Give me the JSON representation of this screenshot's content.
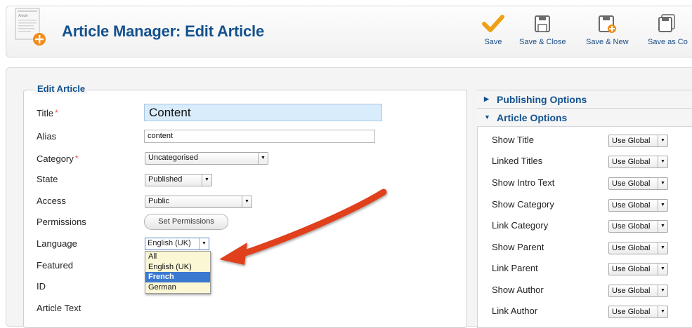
{
  "header": {
    "title": "Article Manager: Edit Article",
    "icon_text": "Article"
  },
  "toolbar": {
    "save": "Save",
    "save_close": "Save & Close",
    "save_new": "Save & New",
    "save_copy": "Save as Co"
  },
  "form": {
    "legend": "Edit Article",
    "labels": {
      "title": "Title",
      "alias": "Alias",
      "category": "Category",
      "state": "State",
      "access": "Access",
      "permissions": "Permissions",
      "language": "Language",
      "featured": "Featured",
      "id": "ID",
      "article_text": "Article Text"
    },
    "required_marker": "*",
    "values": {
      "title": "Content",
      "alias": "content",
      "category": "Uncategorised",
      "state": "Published",
      "access": "Public",
      "language": "English (UK)"
    },
    "set_permissions": "Set Permissions",
    "language_options": [
      "All",
      "English (UK)",
      "French",
      "German"
    ],
    "language_highlighted": "French"
  },
  "sidebar": {
    "publishing_options": "Publishing Options",
    "article_options": "Article Options",
    "options": [
      {
        "label": "Show Title",
        "value": "Use Global"
      },
      {
        "label": "Linked Titles",
        "value": "Use Global"
      },
      {
        "label": "Show Intro Text",
        "value": "Use Global"
      },
      {
        "label": "Show Category",
        "value": "Use Global"
      },
      {
        "label": "Link Category",
        "value": "Use Global"
      },
      {
        "label": "Show Parent",
        "value": "Use Global"
      },
      {
        "label": "Link Parent",
        "value": "Use Global"
      },
      {
        "label": "Show Author",
        "value": "Use Global"
      },
      {
        "label": "Link Author",
        "value": "Use Global"
      }
    ]
  },
  "colors": {
    "accent": "#14528e",
    "arrow": "#e0401f",
    "title_input_bg": "#d9ecfb",
    "highlight": "#3b79d1"
  }
}
